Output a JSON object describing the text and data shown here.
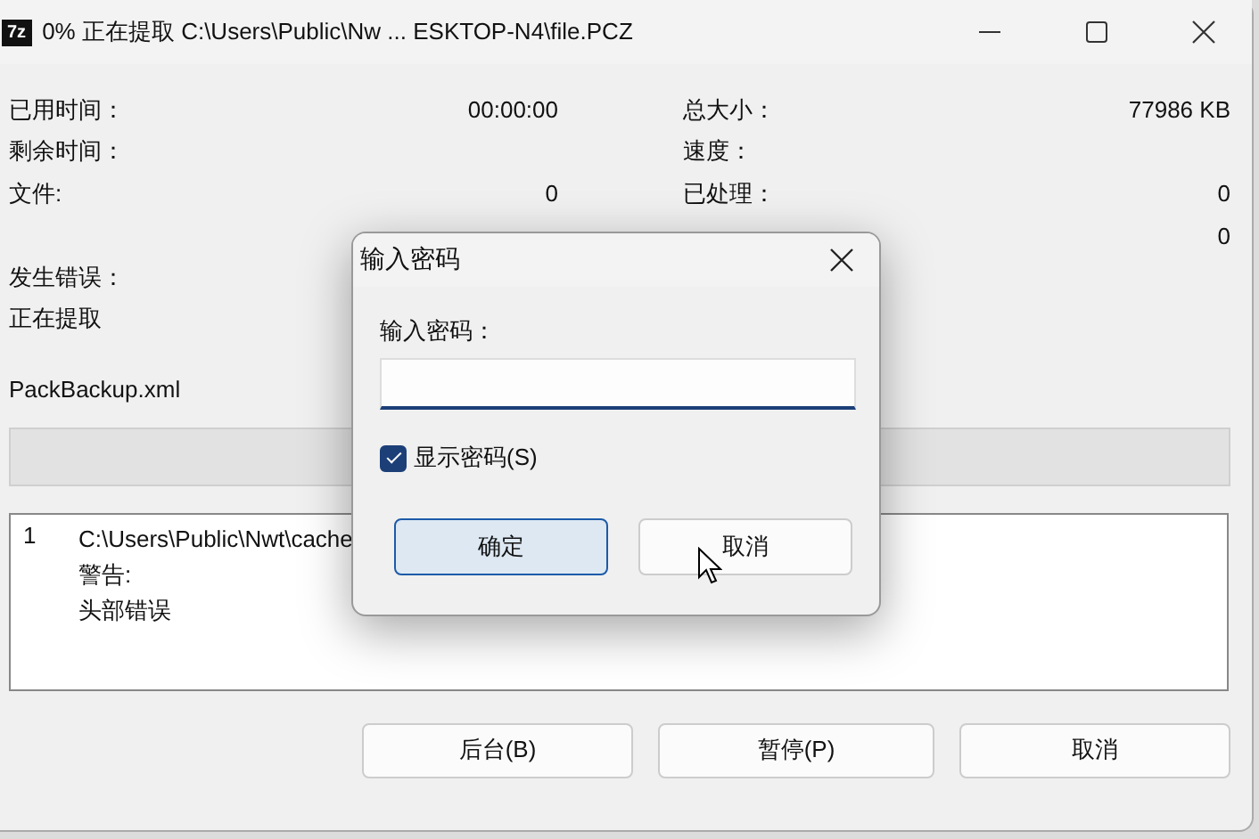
{
  "window": {
    "app_icon": "7z",
    "title": "0% 正在提取 C:\\Users\\Public\\Nw ... ESKTOP-N4\\file.PCZ"
  },
  "stats": [
    {
      "left": {
        "label": "已用时间：",
        "value": "00:00:00"
      },
      "right": {
        "label": "总大小：",
        "value": "77986 KB"
      }
    },
    {
      "left": {
        "label": "剩余时间："
      },
      "right": {
        "label": "速度："
      }
    },
    {
      "left": {
        "label": "文件:",
        "value": "0"
      },
      "right": {
        "label": "已处理：",
        "value": "0"
      }
    },
    {
      "right": {
        "value": "0"
      }
    },
    {
      "left": {
        "label": "发生错误："
      }
    }
  ],
  "status": "正在提取",
  "current_file": "PackBackup.xml",
  "progress": {
    "level": 0
  },
  "log": [
    {
      "number": "1",
      "lines": [
        "C:\\Users\\Public\\Nwt\\cache",
        "警告:",
        "头部错误"
      ]
    }
  ],
  "buttons": [
    {
      "label": "后台(B)"
    },
    {
      "label": "暂停(P)"
    },
    {
      "label": "取消"
    }
  ],
  "dialog": {
    "title": "输入密码",
    "field_label": "输入密码：",
    "show_password": {
      "label": "显示密码(S)",
      "checked": true
    },
    "buttons": [
      {
        "label": "确定",
        "default": true
      },
      {
        "label": "取消",
        "default": false
      }
    ]
  }
}
